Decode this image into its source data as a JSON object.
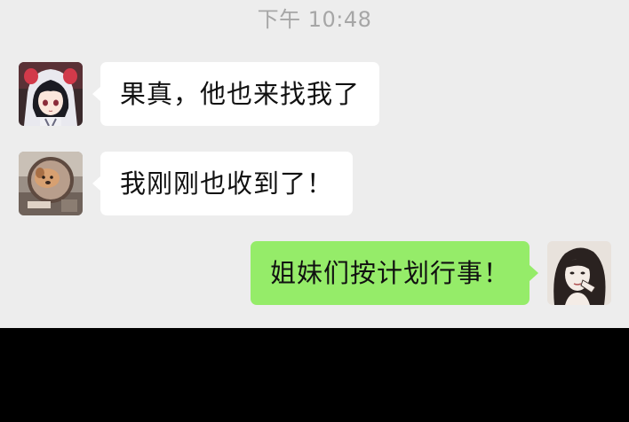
{
  "timestamp": "下午 10:48",
  "messages": [
    {
      "sender_avatar": "anime-girl-hood-avatar",
      "side": "incoming",
      "text": "果真，他也来找我了"
    },
    {
      "sender_avatar": "dog-photo-avatar",
      "side": "incoming",
      "text": "我刚刚也收到了！"
    },
    {
      "sender_avatar": "woman-sketch-avatar",
      "side": "outgoing",
      "text": "姐妹们按计划行事！"
    }
  ],
  "colors": {
    "chat_background": "#ededed",
    "incoming_bubble": "#ffffff",
    "outgoing_bubble": "#95ec69",
    "timestamp_text": "#a6a6a6",
    "message_text": "#111111",
    "bottom_bar": "#000000"
  }
}
